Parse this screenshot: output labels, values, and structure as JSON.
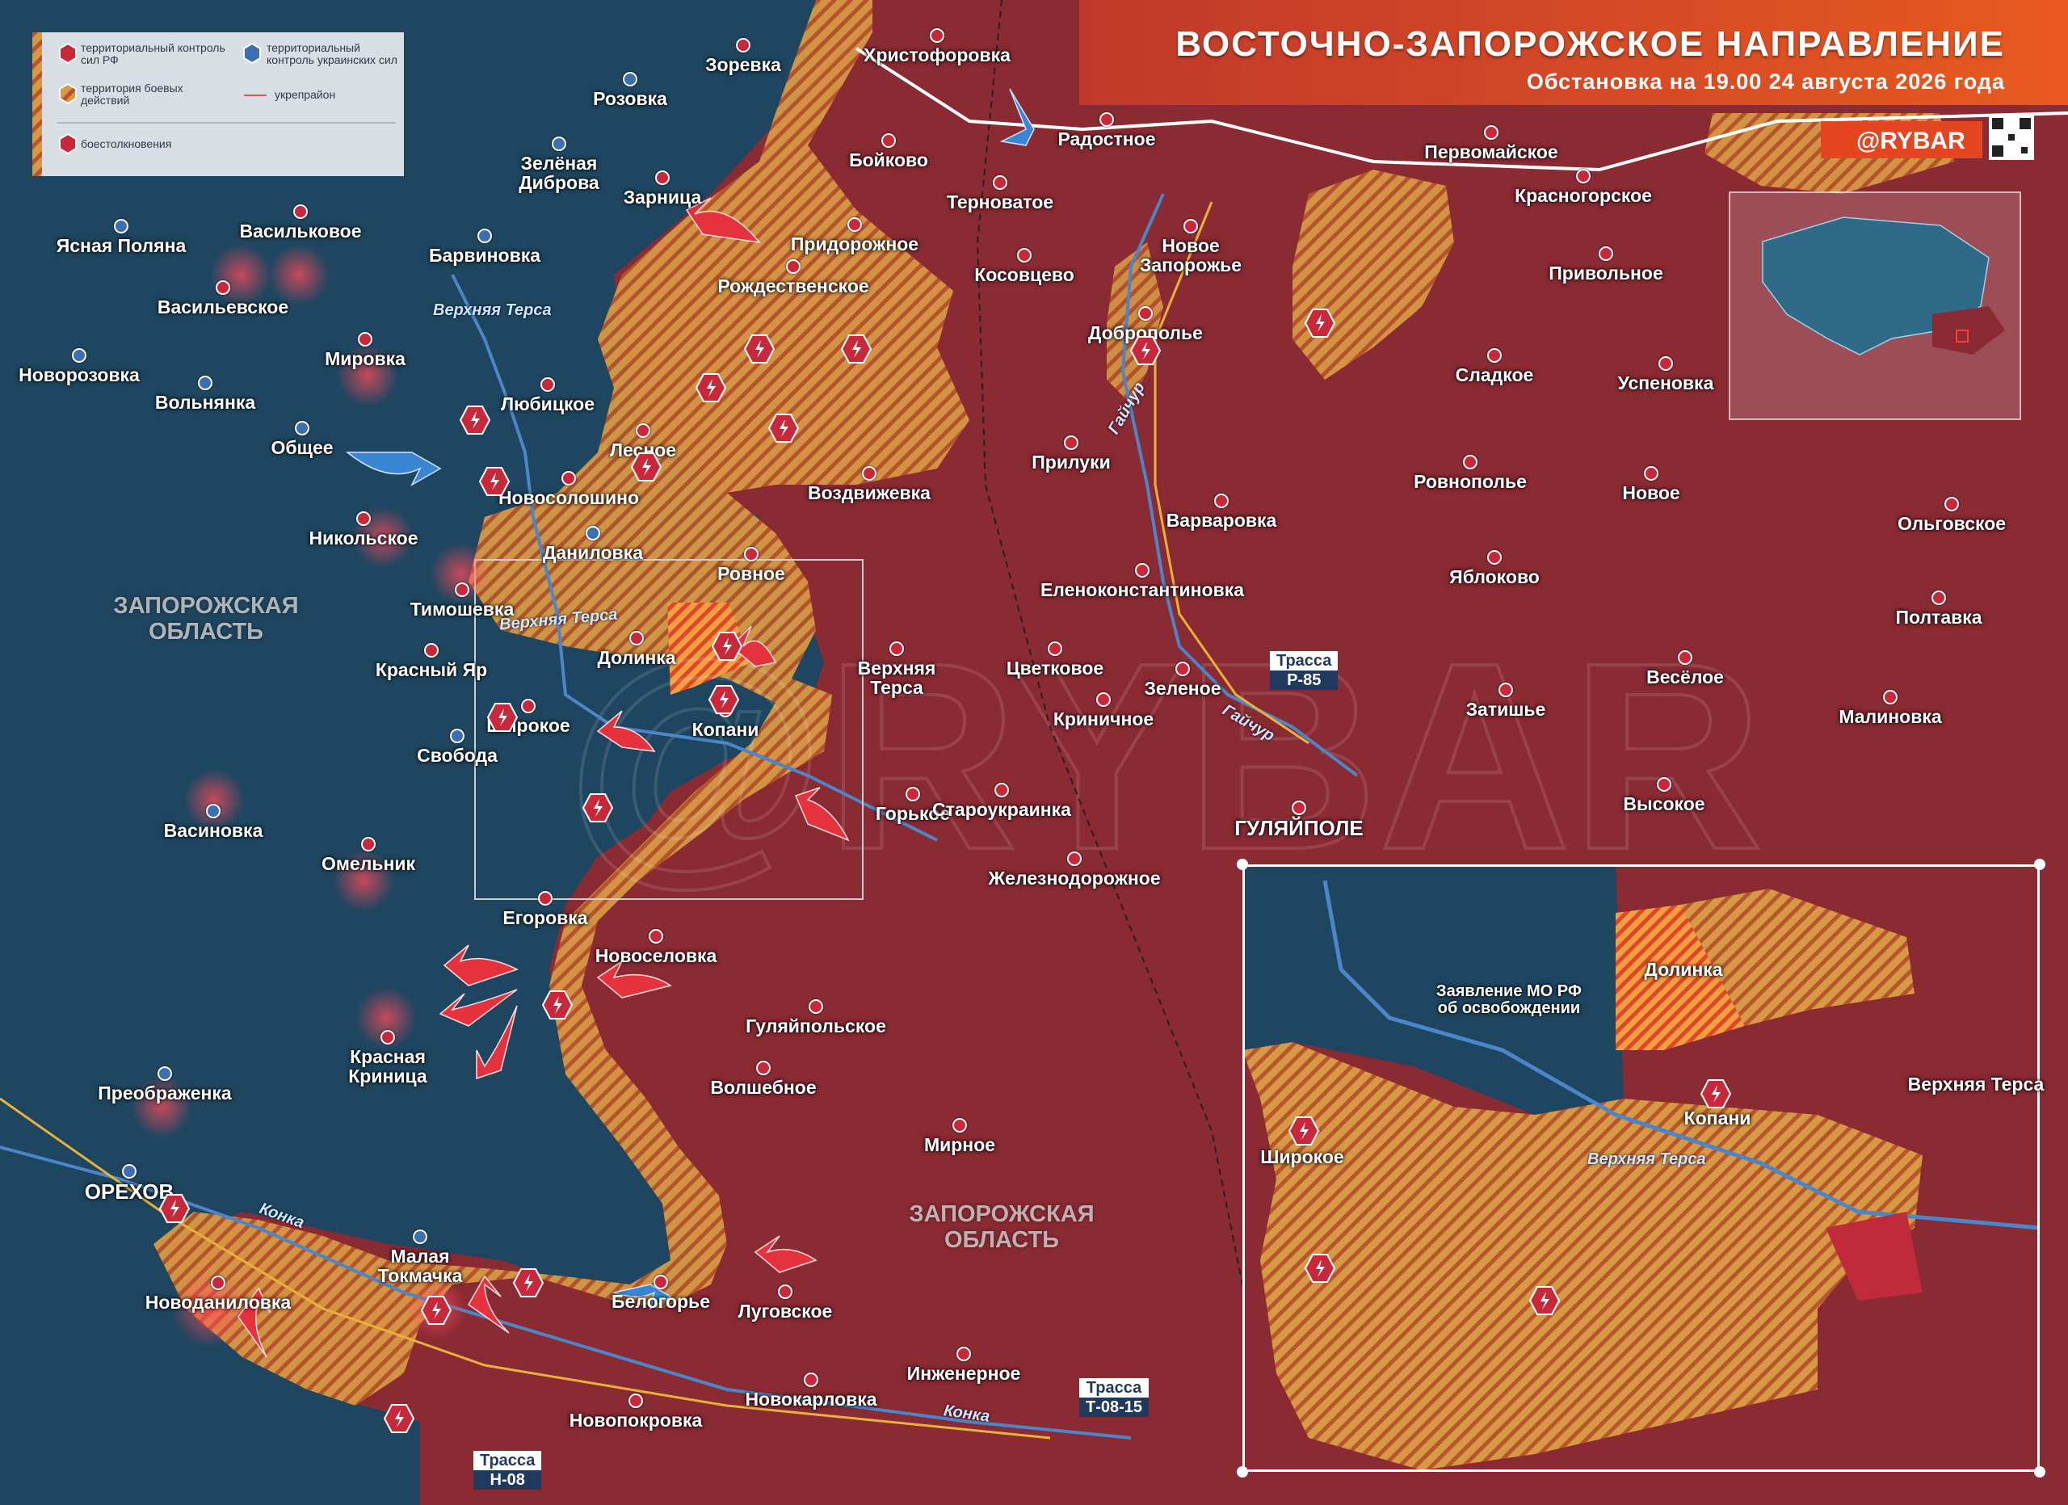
{
  "header": {
    "title": "ВОСТОЧНО-ЗАПОРОЖСКОЕ НАПРАВЛЕНИЕ",
    "subtitle": "Обстановка на 19.00 24 августа 2026 года",
    "brand": "@RYBAR",
    "accent_color": "#e34621"
  },
  "legend": {
    "ru_control": "территориальный контроль сил РФ",
    "ua_control": "территориальный контроль украинских сил",
    "contested": "территория боевых действий",
    "fortified": "укрепрайон",
    "clashes": "боестолкновения",
    "colors": {
      "ru": "#8f2a33",
      "ua": "#1f4b66",
      "contested": "#d9973a",
      "fortified": "#e0584f"
    }
  },
  "regions": [
    {
      "name": "ЗАПОРОЖСКАЯ ОБЛАСТЬ",
      "line1": "ЗАПОРОЖСКАЯ",
      "line2": "ОБЛАСТЬ"
    }
  ],
  "rivers": {
    "verkhnyaya_tersa": "Верхняя Терса",
    "gaichur": "Гайчур",
    "konka": "Конка"
  },
  "routes": [
    {
      "label": "Трасса",
      "code": "Р-85"
    },
    {
      "label": "Трасса",
      "code": "Т-08-15"
    },
    {
      "label": "Трасса",
      "code": "Н-08"
    }
  ],
  "places": [
    "Зоревка",
    "Христофоровка",
    "Радостное",
    "Бойково",
    "Терноватое",
    "Первомайское",
    "Красногорское",
    "Розовка",
    "Зелёная Диброва",
    "Зарница",
    "Придорожное",
    "Косовцево",
    "Новое Запорожье",
    "Привольное",
    "Ясная Поляна",
    "Васильковое",
    "Барвиновка",
    "Рождественское",
    "Доброполье",
    "Сладкое",
    "Успеновка",
    "Васильевское",
    "Мировка",
    "Новорозовка",
    "Вольнянка",
    "Общее",
    "Любицкое",
    "Лесное",
    "Воздвижевка",
    "Прилуки",
    "Ровнополье",
    "Новое",
    "Новосолошино",
    "Варваровка",
    "Ольговское",
    "Никольское",
    "Даниловка",
    "Ровное",
    "Еленоконстантиновка",
    "Яблоково",
    "Тимошевка",
    "Полтавка",
    "Долинка",
    "Верхняя Терса",
    "Цветковое",
    "Красный Яр",
    "Зеленое",
    "Весёлое",
    "Широкое",
    "Копани",
    "Криничное",
    "Затишье",
    "Малиновка",
    "Свобода",
    "Горькое",
    "Староукраинка",
    "Гуляйполе",
    "Высокое",
    "Васиновка",
    "Омельник",
    "Железнодорожное",
    "Егоровка",
    "Новоселовка",
    "Гуляйпольское",
    "Красная Криница",
    "Преображенка",
    "Волшебное",
    "Мирное",
    "Орехов",
    "Конка",
    "Малая Токмачка",
    "Новоданиловка",
    "Белогорье",
    "Луговское",
    "Инженерное",
    "Новокарловка",
    "Новопокровка"
  ],
  "inset": {
    "statement": "Заявление МО РФ об освобождении",
    "statement_line1": "Заявление МО РФ",
    "statement_line2": "об освобождении",
    "places": [
      "Долинка",
      "Копани",
      "Широкое",
      "Верхняя Терса"
    ],
    "river": "Верхняя Терса"
  }
}
